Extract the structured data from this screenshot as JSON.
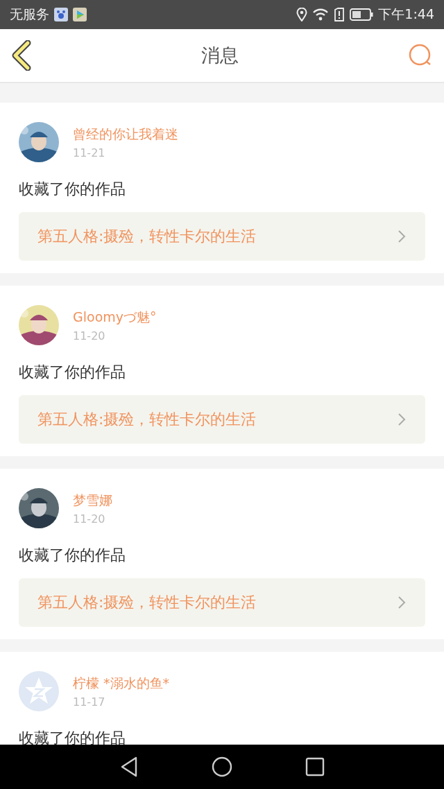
{
  "status_bar": {
    "carrier": "无服务",
    "time": "下午1:44"
  },
  "header": {
    "title": "消息"
  },
  "messages": [
    {
      "name": "曾经的你让我着迷",
      "date": "11-21",
      "action": "收藏了你的作品",
      "work": "第五人格:摄殓，转性卡尔的生活"
    },
    {
      "name": "Gloomyづ魅°",
      "date": "11-20",
      "action": "收藏了你的作品",
      "work": "第五人格:摄殓，转性卡尔的生活"
    },
    {
      "name": "梦雪娜",
      "date": "11-20",
      "action": "收藏了你的作品",
      "work": "第五人格:摄殓，转性卡尔的生活"
    },
    {
      "avatar": {
        "kind": "default"
      },
      "name": "柠檬 *溺水的鱼*",
      "date": "11-17",
      "action": "收藏了你的作品"
    }
  ]
}
